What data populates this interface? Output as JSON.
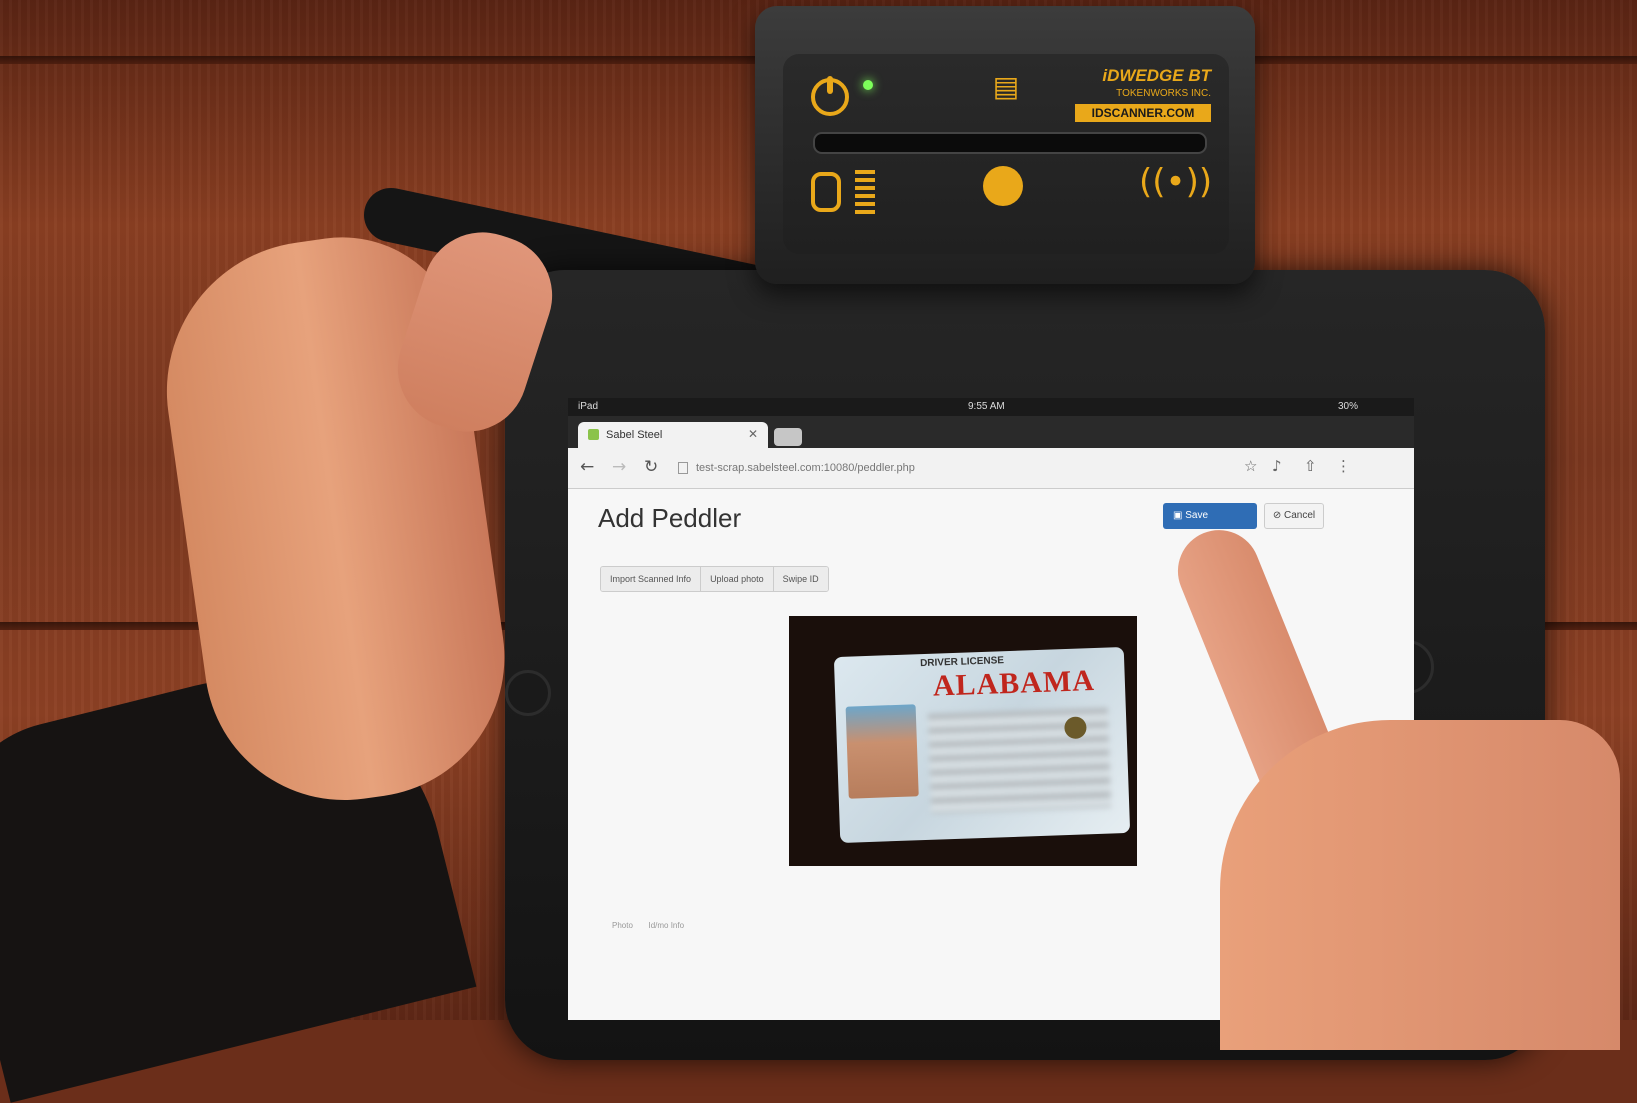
{
  "scanner": {
    "brand": "iDWEDGE BT",
    "maker": "TOKENWORKS INC.",
    "site": "IDSCANNER.COM"
  },
  "tablet": {
    "status_left": "iPad",
    "status_time": "9:55 AM",
    "status_right": "30%",
    "tab_title": "Sabel Steel",
    "url": "test-scrap.sabelsteel.com:10080/peddler.php",
    "page_title": "Add Peddler",
    "save_label": "Save",
    "cancel_label": "Cancel",
    "actions": [
      "Import Scanned Info",
      "Upload photo",
      "Swipe ID"
    ],
    "license_header": "DRIVER LICENSE",
    "license_state": "ALABAMA",
    "footer_items": [
      "Photo",
      "Id/mo Info"
    ]
  }
}
